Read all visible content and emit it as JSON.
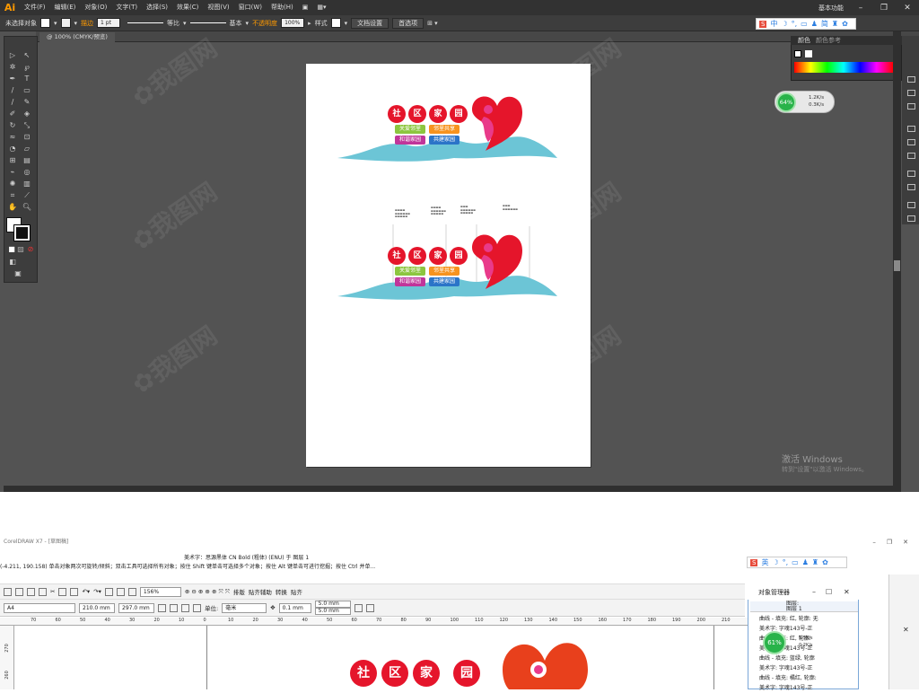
{
  "ai": {
    "logo": "Ai",
    "menu": [
      "文件(F)",
      "编辑(E)",
      "对象(O)",
      "文字(T)",
      "选择(S)",
      "效果(C)",
      "视图(V)",
      "窗口(W)",
      "帮助(H)"
    ],
    "workspace": "基本功能",
    "control": {
      "selection": "未选择对象",
      "stroke_label": "描边",
      "stroke_value": "1 pt",
      "profile": "等比",
      "brush": "基本",
      "opacity_label": "不透明度",
      "opacity_value": "100%",
      "style_label": "样式",
      "doc_setup": "文档设置",
      "preferences": "首选项"
    },
    "doc_tab": "@ 100% (CMYK/预览)",
    "color_panel": {
      "tab1": "颜色",
      "tab2": "颜色参考"
    },
    "ime": [
      "中",
      "简"
    ],
    "net": {
      "percent": "64%",
      "up": "1.2K/s",
      "down": "0.3K/s"
    },
    "activate": {
      "title": "激活 Windows",
      "sub": "转到\"设置\"以激活 Windows。"
    }
  },
  "banner": {
    "chars": [
      "社",
      "区",
      "家",
      "园"
    ],
    "pills_top": [
      "关爱邻里",
      "邻里共享"
    ],
    "pills_bottom": [
      "和谐家园",
      "共建家园"
    ],
    "colors": {
      "red": "#e5152b",
      "green": "#8cc63f",
      "orange": "#f7931e",
      "purple": "#c0359a",
      "blue": "#2b74c8",
      "wave": "#6cc5d6",
      "pink": "#e93a8a"
    }
  },
  "cd": {
    "title": "CorelDRAW X7 - [草图稿]",
    "status_line1": "美术字：思源黑体 CN Bold (粗体) (ENU) 于 图层 1",
    "status_line2": "(-4.211, 190.158)    单击对象两次可旋转/倾斜；双击工具可选择所有对象；按住 Shift 键单击可选择多个对象；按住 Alt 键单击可进行挖掘；按住 Ctrl 并单...",
    "zoom": "156%",
    "toolbar": [
      "排版",
      "贴齐辅助",
      "转换",
      "贴齐"
    ],
    "paper": "A4",
    "width": "210.0 mm",
    "height": "297.0 mm",
    "unit_label": "单位:",
    "unit": "毫米",
    "nudge": "0.1 mm",
    "dup_x": "5.0 mm",
    "dup_y": "5.0 mm",
    "ruler_ticks": [
      "70",
      "60",
      "50",
      "40",
      "30",
      "20",
      "10",
      "0",
      "10",
      "20",
      "30",
      "40",
      "50",
      "60",
      "70",
      "80",
      "90",
      "100",
      "110",
      "120",
      "130",
      "140",
      "150",
      "160",
      "170",
      "180",
      "190",
      "200",
      "210"
    ],
    "vruler": [
      "270",
      "260"
    ],
    "ime": [
      "英"
    ],
    "net": {
      "percent": "61%",
      "up": "5.5K/s",
      "down": "0.2K/s"
    },
    "obj_panel": {
      "title": "对象管理器",
      "layers": "图层:",
      "layer1": "图层 1",
      "rows": [
        "曲线 - 填充: 红, 轮廓: 无",
        "美术字: 字魂143号-正",
        "曲线 - 填充: 红, 轮廓:",
        "美术字: 字魂143号-正",
        "曲线 - 填充: 蓝绿, 轮廓",
        "美术字: 字魂143号-正",
        "曲线 - 填充: 橘红, 轮廓:",
        "美术字: 字魂143号-正"
      ]
    }
  }
}
